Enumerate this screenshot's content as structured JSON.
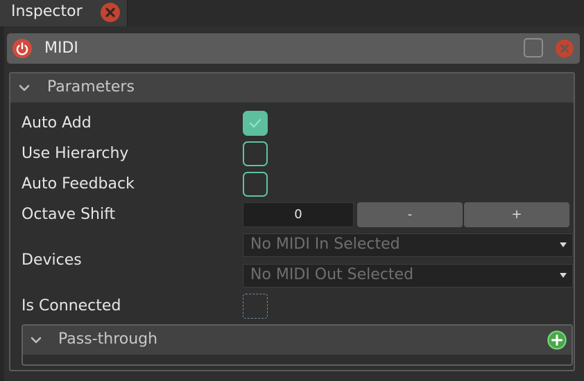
{
  "tab": {
    "title": "Inspector",
    "close_icon": "close-icon"
  },
  "module": {
    "title": "MIDI",
    "power_icon": "power-icon",
    "close_icon": "close-icon"
  },
  "parameters": {
    "title": "Parameters",
    "rows": {
      "auto_add": {
        "label": "Auto Add",
        "checked": true
      },
      "use_hierarchy": {
        "label": "Use Hierarchy",
        "checked": false
      },
      "auto_feedback": {
        "label": "Auto Feedback",
        "checked": false
      },
      "octave_shift": {
        "label": "Octave Shift",
        "value": "0",
        "minus": "-",
        "plus": "+"
      },
      "devices": {
        "label": "Devices",
        "midi_in": "No MIDI In Selected",
        "midi_out": "No MIDI Out Selected"
      },
      "is_connected": {
        "label": "Is Connected",
        "checked": false
      }
    }
  },
  "pass_through": {
    "title": "Pass-through",
    "add_icon": "plus-icon"
  },
  "colors": {
    "accent": "#5dbf9d",
    "close": "#c4442f",
    "add": "#4aa84b",
    "background": "#2f2f2f"
  }
}
